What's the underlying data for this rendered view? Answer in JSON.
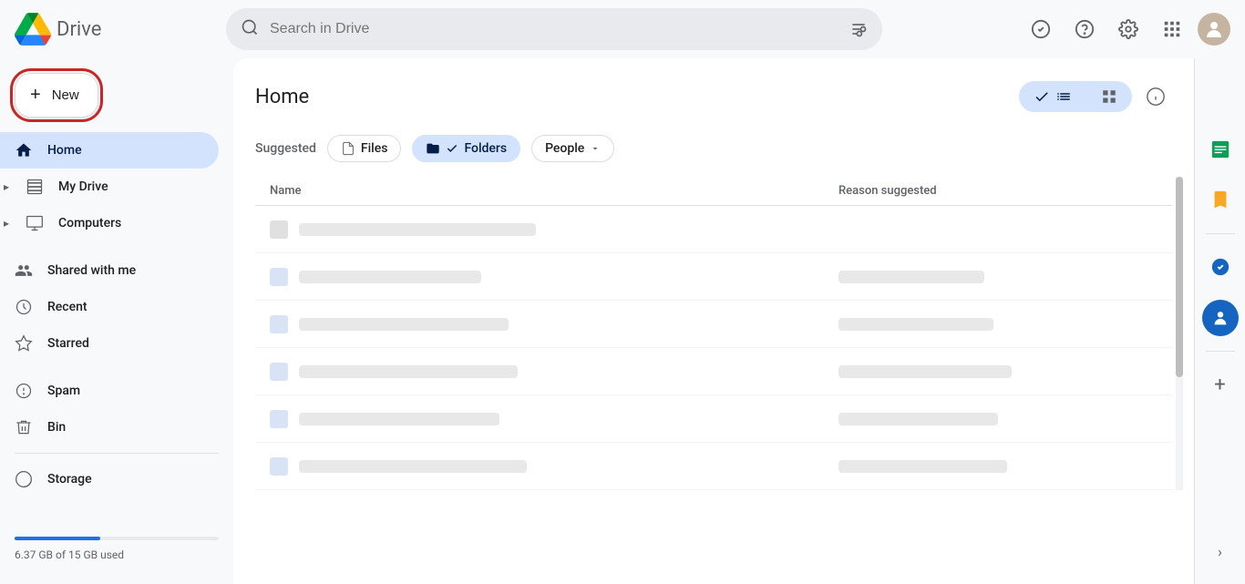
{
  "app": {
    "name": "Drive",
    "logo_alt": "Google Drive"
  },
  "topbar": {
    "search_placeholder": "Search in Drive",
    "icons": {
      "search": "🔍",
      "filter": "⊟",
      "check": "✓",
      "help": "?",
      "settings": "⚙",
      "apps": "⋮⋮⋮",
      "avatar": "👤"
    }
  },
  "sidebar": {
    "new_button": "New",
    "nav_items": [
      {
        "id": "home",
        "label": "Home",
        "icon": "🏠",
        "active": true
      },
      {
        "id": "my-drive",
        "label": "My Drive",
        "icon": "📁",
        "active": false,
        "expandable": true
      },
      {
        "id": "computers",
        "label": "Computers",
        "icon": "🖥",
        "active": false,
        "expandable": true
      },
      {
        "id": "shared-with-me",
        "label": "Shared with me",
        "icon": "👥",
        "active": false
      },
      {
        "id": "recent",
        "label": "Recent",
        "icon": "🕐",
        "active": false
      },
      {
        "id": "starred",
        "label": "Starred",
        "icon": "☆",
        "active": false
      },
      {
        "id": "spam",
        "label": "Spam",
        "icon": "🚫",
        "active": false
      },
      {
        "id": "bin",
        "label": "Bin",
        "icon": "🗑",
        "active": false
      },
      {
        "id": "storage",
        "label": "Storage",
        "icon": "☁",
        "active": false
      }
    ],
    "storage": {
      "used_text": "6.37 GB of 15 GB used",
      "percent": 42
    }
  },
  "main": {
    "title": "Home",
    "view_toggle": {
      "list_label": "List",
      "grid_label": "Grid"
    },
    "filter": {
      "suggested_label": "Suggested",
      "chips": [
        {
          "id": "files",
          "label": "Files",
          "active": false
        },
        {
          "id": "folders",
          "label": "Folders",
          "active": true
        },
        {
          "id": "people",
          "label": "People",
          "active": false,
          "has_dropdown": true
        }
      ]
    },
    "table": {
      "col_name": "Name",
      "col_reason": "Reason suggested",
      "rows": [
        {
          "id": 1,
          "name_width": 260,
          "reason_width": 180,
          "has_reason": false
        },
        {
          "id": 2,
          "name_width": 200,
          "reason_width": 160,
          "has_reason": true
        },
        {
          "id": 3,
          "name_width": 230,
          "reason_width": 170,
          "has_reason": true
        },
        {
          "id": 4,
          "name_width": 240,
          "reason_width": 190,
          "has_reason": true
        },
        {
          "id": 5,
          "name_width": 220,
          "reason_width": 175,
          "has_reason": true
        },
        {
          "id": 6,
          "name_width": 250,
          "reason_width": 185,
          "has_reason": true
        }
      ]
    }
  },
  "right_panel": {
    "icons": [
      {
        "id": "calendar",
        "symbol": "📅",
        "color": "#1e88e5"
      },
      {
        "id": "keep",
        "symbol": "📌",
        "color": "#f9a825"
      },
      {
        "id": "tasks",
        "symbol": "✓",
        "color": "#1565c0"
      },
      {
        "id": "contacts",
        "symbol": "👤",
        "color": "#1565c0"
      }
    ],
    "add_label": "+"
  },
  "colors": {
    "active_nav_bg": "#d3e3fd",
    "active_chip_bg": "#d3e3fd",
    "storage_bar": "#1a73e8",
    "new_btn_outline": "#c62828"
  }
}
